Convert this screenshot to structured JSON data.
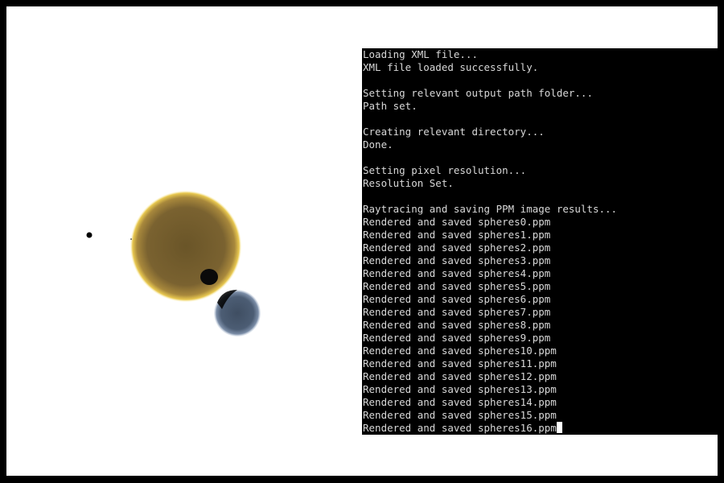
{
  "render": {
    "spheres": [
      {
        "name": "tiny-black-sphere",
        "color": "#000000"
      },
      {
        "name": "large-gold-sphere",
        "color": "#6e5a2e",
        "rim": "#f0d060"
      },
      {
        "name": "blue-gray-sphere",
        "color": "#4a5a70",
        "rim": "#a8b8d0"
      },
      {
        "name": "small-dark-sphere",
        "color": "#0a0a0a"
      }
    ]
  },
  "console": {
    "lines": [
      "Loading XML file...",
      "XML file loaded successfully.",
      "",
      "Setting relevant output path folder...",
      "Path set.",
      "",
      "Creating relevant directory...",
      "Done.",
      "",
      "Setting pixel resolution...",
      "Resolution Set.",
      "",
      "Raytracing and saving PPM image results...",
      "Rendered and saved spheres0.ppm",
      "Rendered and saved spheres1.ppm",
      "Rendered and saved spheres2.ppm",
      "Rendered and saved spheres3.ppm",
      "Rendered and saved spheres4.ppm",
      "Rendered and saved spheres5.ppm",
      "Rendered and saved spheres6.ppm",
      "Rendered and saved spheres7.ppm",
      "Rendered and saved spheres8.ppm",
      "Rendered and saved spheres9.ppm",
      "Rendered and saved spheres10.ppm",
      "Rendered and saved spheres11.ppm",
      "Rendered and saved spheres12.ppm",
      "Rendered and saved spheres13.ppm",
      "Rendered and saved spheres14.ppm",
      "Rendered and saved spheres15.ppm",
      "Rendered and saved spheres16.ppm"
    ]
  }
}
